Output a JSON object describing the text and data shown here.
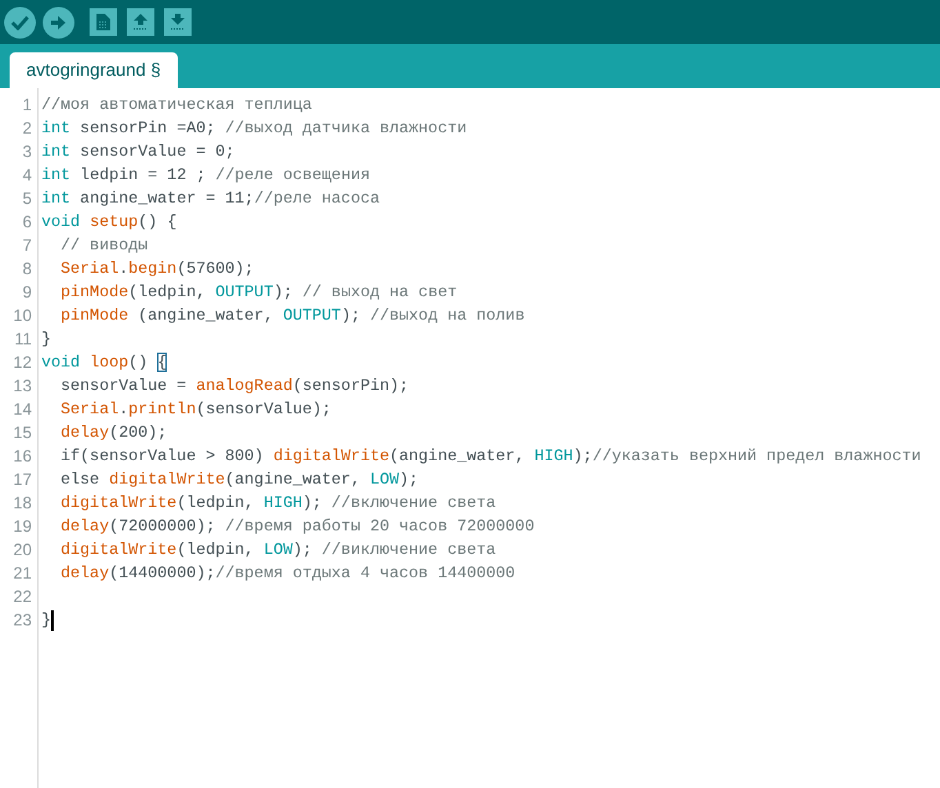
{
  "tabs": [
    {
      "label": "avtogringraund §",
      "selected": true
    }
  ],
  "lines": [
    {
      "number": "1",
      "indented": false,
      "tokens": [
        {
          "kind": "comment",
          "t": "//моя автоматическая теплица"
        }
      ]
    },
    {
      "number": "2",
      "indented": false,
      "tokens": [
        {
          "kind": "type",
          "t": "int"
        },
        {
          "kind": "plain",
          "t": " sensorPin =A0; "
        },
        {
          "kind": "comment",
          "t": "//выход датчика влажности"
        }
      ]
    },
    {
      "number": "3",
      "indented": false,
      "tokens": [
        {
          "kind": "type",
          "t": "int"
        },
        {
          "kind": "plain",
          "t": " sensorValue = 0;"
        }
      ]
    },
    {
      "number": "4",
      "indented": false,
      "tokens": [
        {
          "kind": "type",
          "t": "int"
        },
        {
          "kind": "plain",
          "t": " ledpin = 12 ; "
        },
        {
          "kind": "comment",
          "t": "//реле освещения"
        }
      ]
    },
    {
      "number": "5",
      "indented": false,
      "tokens": [
        {
          "kind": "type",
          "t": "int"
        },
        {
          "kind": "plain",
          "t": " angine_water = 11;"
        },
        {
          "kind": "comment",
          "t": "//реле насоса"
        }
      ]
    },
    {
      "number": "6",
      "indented": false,
      "tokens": [
        {
          "kind": "type",
          "t": "void"
        },
        {
          "kind": "func",
          "t": " setup"
        },
        {
          "kind": "plain",
          "t": "() {"
        }
      ]
    },
    {
      "number": "7",
      "indented": true,
      "tokens": [
        {
          "kind": "comment",
          "t": "// виводы"
        }
      ]
    },
    {
      "number": "8",
      "indented": true,
      "tokens": [
        {
          "kind": "func",
          "t": "Serial"
        },
        {
          "kind": "plain",
          "t": "."
        },
        {
          "kind": "func",
          "t": "begin"
        },
        {
          "kind": "plain",
          "t": "(57600);"
        }
      ]
    },
    {
      "number": "9",
      "indented": true,
      "tokens": [
        {
          "kind": "func",
          "t": "pinMode"
        },
        {
          "kind": "plain",
          "t": "(ledpin, "
        },
        {
          "kind": "const",
          "t": "OUTPUT"
        },
        {
          "kind": "plain",
          "t": "); "
        },
        {
          "kind": "comment",
          "t": "// выход на свет"
        }
      ]
    },
    {
      "number": "10",
      "indented": true,
      "tokens": [
        {
          "kind": "func",
          "t": "pinMode"
        },
        {
          "kind": "plain",
          "t": " (angine_water, "
        },
        {
          "kind": "const",
          "t": "OUTPUT"
        },
        {
          "kind": "plain",
          "t": "); "
        },
        {
          "kind": "comment",
          "t": "//выход на полив"
        }
      ]
    },
    {
      "number": "11",
      "indented": false,
      "tokens": [
        {
          "kind": "plain",
          "t": "}"
        }
      ]
    },
    {
      "number": "12",
      "indented": false,
      "tokens": [
        {
          "kind": "type",
          "t": "void"
        },
        {
          "kind": "func",
          "t": " loop"
        },
        {
          "kind": "plain",
          "t": "() "
        },
        {
          "kind": "bracket",
          "t": "{"
        }
      ]
    },
    {
      "number": "13",
      "indented": true,
      "tokens": [
        {
          "kind": "plain",
          "t": "sensorValue = "
        },
        {
          "kind": "func",
          "t": "analogRead"
        },
        {
          "kind": "plain",
          "t": "(sensorPin);"
        }
      ]
    },
    {
      "number": "14",
      "indented": true,
      "tokens": [
        {
          "kind": "func",
          "t": "Serial"
        },
        {
          "kind": "plain",
          "t": "."
        },
        {
          "kind": "func",
          "t": "println"
        },
        {
          "kind": "plain",
          "t": "(sensorValue);"
        }
      ]
    },
    {
      "number": "15",
      "indented": true,
      "tokens": [
        {
          "kind": "func",
          "t": "delay"
        },
        {
          "kind": "plain",
          "t": "(200);"
        }
      ]
    },
    {
      "number": "16",
      "indented": true,
      "tokens": [
        {
          "kind": "plain",
          "t": "if(sensorValue > 800) "
        },
        {
          "kind": "func",
          "t": "digitalWrite"
        },
        {
          "kind": "plain",
          "t": "(angine_water, "
        },
        {
          "kind": "const",
          "t": "HIGH"
        },
        {
          "kind": "plain",
          "t": ");"
        },
        {
          "kind": "comment",
          "t": "//указать верхний предел влажности"
        }
      ]
    },
    {
      "number": "17",
      "indented": true,
      "tokens": [
        {
          "kind": "plain",
          "t": "else "
        },
        {
          "kind": "func",
          "t": "digitalWrite"
        },
        {
          "kind": "plain",
          "t": "(angine_water, "
        },
        {
          "kind": "const",
          "t": "LOW"
        },
        {
          "kind": "plain",
          "t": ");"
        }
      ]
    },
    {
      "number": "18",
      "indented": true,
      "tokens": [
        {
          "kind": "func",
          "t": "digitalWrite"
        },
        {
          "kind": "plain",
          "t": "(ledpin, "
        },
        {
          "kind": "const",
          "t": "HIGH"
        },
        {
          "kind": "plain",
          "t": "); "
        },
        {
          "kind": "comment",
          "t": "//включение света"
        }
      ]
    },
    {
      "number": "19",
      "indented": true,
      "tokens": [
        {
          "kind": "func",
          "t": "delay"
        },
        {
          "kind": "plain",
          "t": "(72000000); "
        },
        {
          "kind": "comment",
          "t": "//время работы 20 часов 72000000"
        }
      ]
    },
    {
      "number": "20",
      "indented": true,
      "tokens": [
        {
          "kind": "func",
          "t": "digitalWrite"
        },
        {
          "kind": "plain",
          "t": "(ledpin, "
        },
        {
          "kind": "const",
          "t": "LOW"
        },
        {
          "kind": "plain",
          "t": "); "
        },
        {
          "kind": "comment",
          "t": "//виключение света"
        }
      ]
    },
    {
      "number": "21",
      "indented": true,
      "tokens": [
        {
          "kind": "func",
          "t": "delay"
        },
        {
          "kind": "plain",
          "t": "(14400000);"
        },
        {
          "kind": "comment",
          "t": "//время отдыха 4 часов 14400000"
        }
      ]
    },
    {
      "number": "22"
    },
    {
      "number": "23",
      "indented": false,
      "tokens": [
        {
          "kind": "plain",
          "t": "}"
        }
      ],
      "cursor": true
    }
  ]
}
